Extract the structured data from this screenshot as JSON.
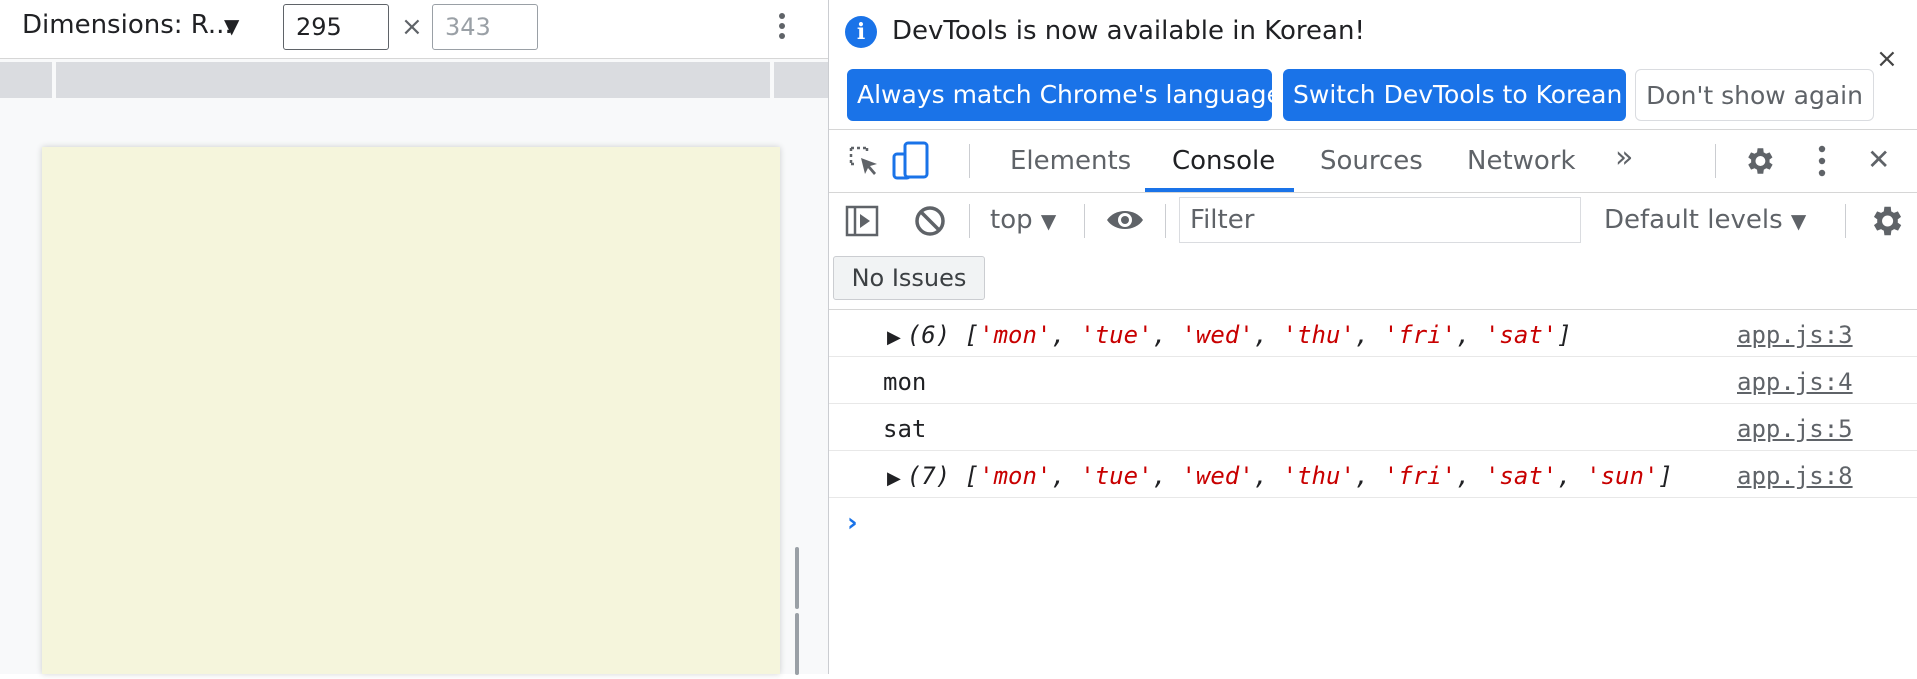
{
  "device_toolbar": {
    "dimensions_label": "Dimensions: R...",
    "width_value": "295",
    "height_value": "343",
    "times_symbol": "×"
  },
  "banner": {
    "message": "DevTools is now available in Korean!",
    "buttons": {
      "match_language": "Always match Chrome's language",
      "switch_korean": "Switch DevTools to Korean",
      "dont_show": "Don't show again"
    },
    "close_symbol": "×"
  },
  "tabs": {
    "items": [
      "Elements",
      "Console",
      "Sources",
      "Network"
    ],
    "active": "Console",
    "more_symbol": "»",
    "close_symbol": "✕"
  },
  "console_toolbar": {
    "context": "top",
    "filter_placeholder": "Filter",
    "levels": "Default levels"
  },
  "issues": {
    "label": "No Issues"
  },
  "console_log": {
    "row1": {
      "count": "(6)",
      "items": [
        "mon",
        "tue",
        "wed",
        "thu",
        "fri",
        "sat"
      ],
      "source": "app.js:3"
    },
    "row2": {
      "text": "mon",
      "source": "app.js:4"
    },
    "row3": {
      "text": "sat",
      "source": "app.js:5"
    },
    "row4": {
      "count": "(7)",
      "items": [
        "mon",
        "tue",
        "wed",
        "thu",
        "fri",
        "sat",
        "sun"
      ],
      "source": "app.js:8"
    }
  },
  "prompt_symbol": "›",
  "colors": {
    "accent": "#1a73e8",
    "string": "#c80000",
    "viewport_bg": "#f5f5dc"
  }
}
